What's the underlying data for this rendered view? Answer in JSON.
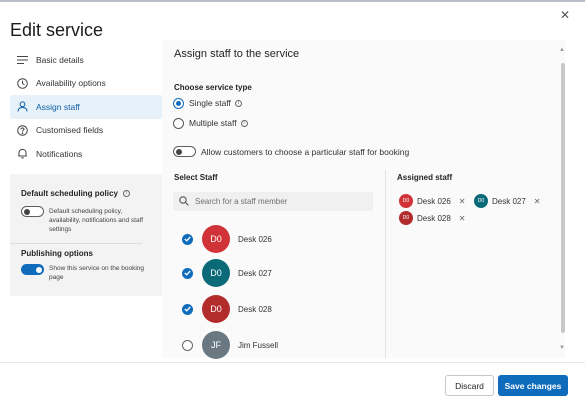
{
  "window": {
    "title": "Edit service",
    "close_glyph": "✕"
  },
  "sidebar": {
    "items": [
      {
        "label": "Basic details",
        "icon": "lines-icon"
      },
      {
        "label": "Availability options",
        "icon": "clock-icon"
      },
      {
        "label": "Assign staff",
        "icon": "person-icon",
        "active": true
      },
      {
        "label": "Customised fields",
        "icon": "question-icon"
      },
      {
        "label": "Notifications",
        "icon": "bell-icon"
      }
    ],
    "scheduling_policy": {
      "title": "Default scheduling policy",
      "toggle_on": false,
      "description": "Default scheduling policy, availability, notifications and staff settings"
    },
    "publishing": {
      "title": "Publishing options",
      "toggle_on": true,
      "description": "Show this service on the booking page"
    }
  },
  "main": {
    "section_title": "Assign staff to the service",
    "service_type": {
      "label": "Choose service type",
      "options": [
        {
          "label": "Single staff",
          "checked": true
        },
        {
          "label": "Multiple staff",
          "checked": false
        }
      ]
    },
    "allow_choice": {
      "label": "Allow customers to choose a particular staff for booking",
      "toggle_on": false
    },
    "select_staff": {
      "label": "Select Staff",
      "search_placeholder": "Search for a staff member",
      "staff": [
        {
          "initials": "D0",
          "name": "Desk 026",
          "checked": true,
          "color": "#d13438"
        },
        {
          "initials": "D0",
          "name": "Desk 027",
          "checked": true,
          "color": "#0b6a78"
        },
        {
          "initials": "D0",
          "name": "Desk 028",
          "checked": true,
          "color": "#b22c2c"
        },
        {
          "initials": "JF",
          "name": "Jim Fussell",
          "checked": false,
          "color": "#6a7882"
        }
      ]
    },
    "assigned_staff": {
      "label": "Assigned staff",
      "chips": [
        {
          "initials": "D0",
          "name": "Desk 026",
          "color": "#d13438"
        },
        {
          "initials": "D0",
          "name": "Desk 027",
          "color": "#0b6a78"
        },
        {
          "initials": "D0",
          "name": "Desk 028",
          "color": "#b22c2c"
        }
      ],
      "remove_glyph": "✕"
    }
  },
  "footer": {
    "discard_label": "Discard",
    "save_label": "Save changes"
  },
  "colors": {
    "accent": "#0f6cbd",
    "active_nav_bg": "#e6f1fa"
  }
}
